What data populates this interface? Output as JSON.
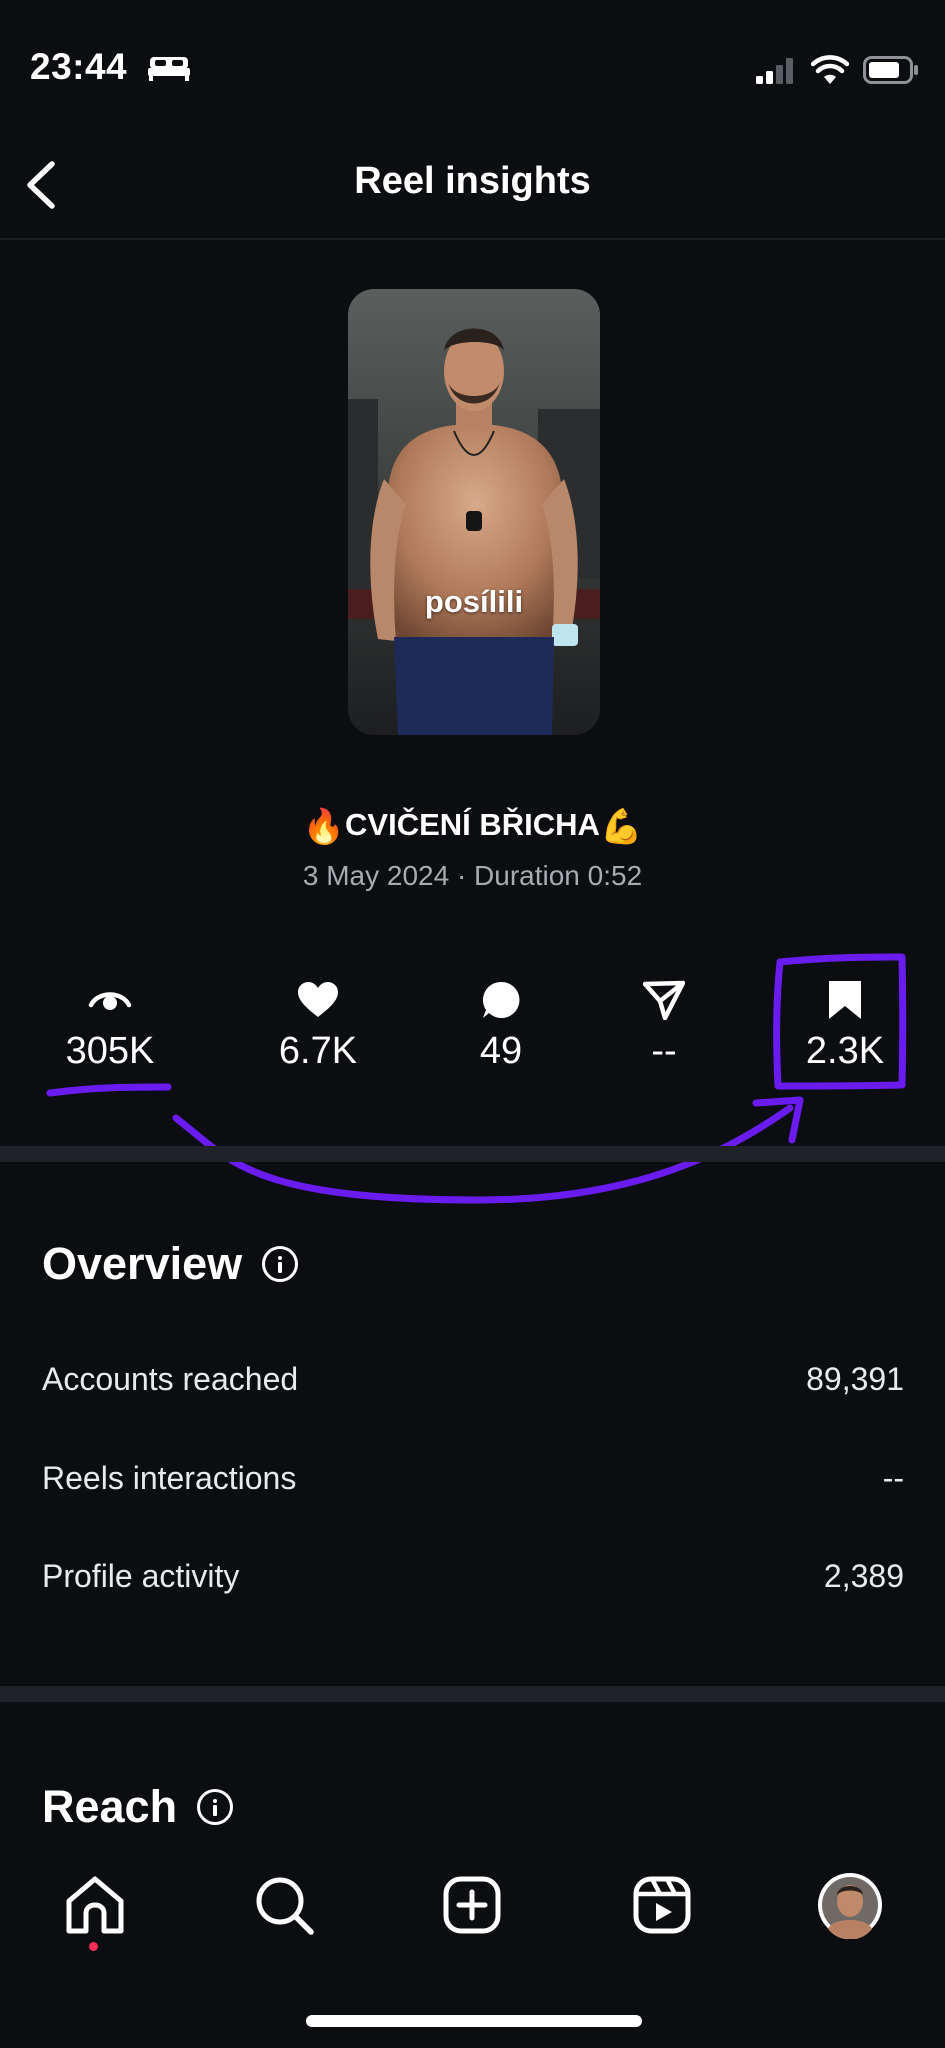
{
  "status_bar": {
    "time": "23:44"
  },
  "header": {
    "title": "Reel insights"
  },
  "reel": {
    "thumbnail_caption": "posílili",
    "title_left_emoji": "🔥",
    "title": "CVIČENÍ BŘICHA",
    "title_right_emoji": "💪",
    "meta": "3 May 2024 · Duration 0:52"
  },
  "stats": {
    "views": "305K",
    "likes": "6.7K",
    "comments": "49",
    "shares": "--",
    "saves": "2.3K"
  },
  "overview": {
    "title": "Overview",
    "rows": [
      {
        "label": "Accounts reached",
        "value": "89,391"
      },
      {
        "label": "Reels interactions",
        "value": "--"
      },
      {
        "label": "Profile activity",
        "value": "2,389"
      }
    ]
  },
  "reach": {
    "title": "Reach"
  },
  "colors": {
    "background": "#0b0d11",
    "annotation": "#6a1cf0",
    "notification_dot": "#ff2d55"
  }
}
